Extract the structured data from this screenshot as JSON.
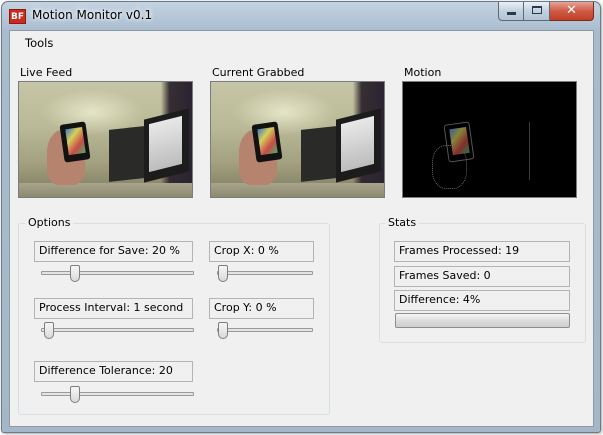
{
  "window": {
    "title": "Motion Monitor v0.1",
    "app_icon_text": "BF",
    "minimize_label": "minimize",
    "maximize_label": "maximize",
    "close_glyph": "✕"
  },
  "menu": {
    "items": [
      {
        "label": "Tools"
      }
    ]
  },
  "feeds": {
    "live_label": "Live Feed",
    "grabbed_label": "Current Grabbed",
    "motion_label": "Motion"
  },
  "options": {
    "title": "Options",
    "difference_for_save": {
      "label": "Difference for Save: 20 %",
      "value": 20,
      "max": 100
    },
    "process_interval": {
      "label": "Process Interval: 1 second",
      "value": 1,
      "max": 60
    },
    "difference_tolerance": {
      "label": "Difference Tolerance: 20",
      "value": 20,
      "max": 100
    },
    "crop_x": {
      "label": "Crop X: 0 %",
      "value": 0,
      "max": 100
    },
    "crop_y": {
      "label": "Crop Y: 0 %",
      "value": 0,
      "max": 100
    }
  },
  "stats": {
    "title": "Stats",
    "frames_processed": "Frames Processed: 19",
    "frames_saved": "Frames Saved: 0",
    "difference": "Difference: 4%",
    "difference_progress_percent": 0
  },
  "colors": {
    "window_frame": "#a9bccf",
    "client_background": "#f0f0f0",
    "close_button": "#c23f28",
    "app_icon": "#cc2a1e"
  }
}
